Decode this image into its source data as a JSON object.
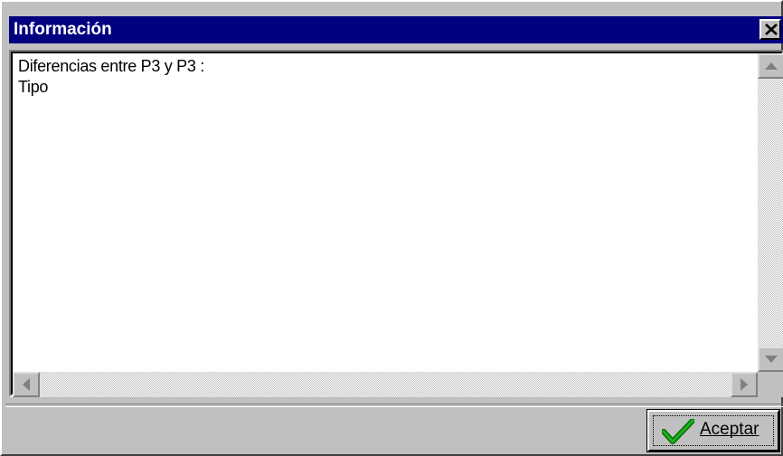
{
  "window": {
    "title": "Información",
    "close_icon": "close-icon"
  },
  "memo": {
    "lines": [
      "Diferencias entre P3 y P3 :",
      "Tipo"
    ]
  },
  "scrollbars": {
    "up_icon": "arrow-up-icon",
    "down_icon": "arrow-down-icon",
    "left_icon": "arrow-left-icon",
    "right_icon": "arrow-right-icon"
  },
  "footer": {
    "ok_label": "Aceptar",
    "ok_icon": "checkmark-icon"
  },
  "colors": {
    "titlebar": "#000080",
    "face": "#c0c0c0",
    "check": "#00a000"
  }
}
